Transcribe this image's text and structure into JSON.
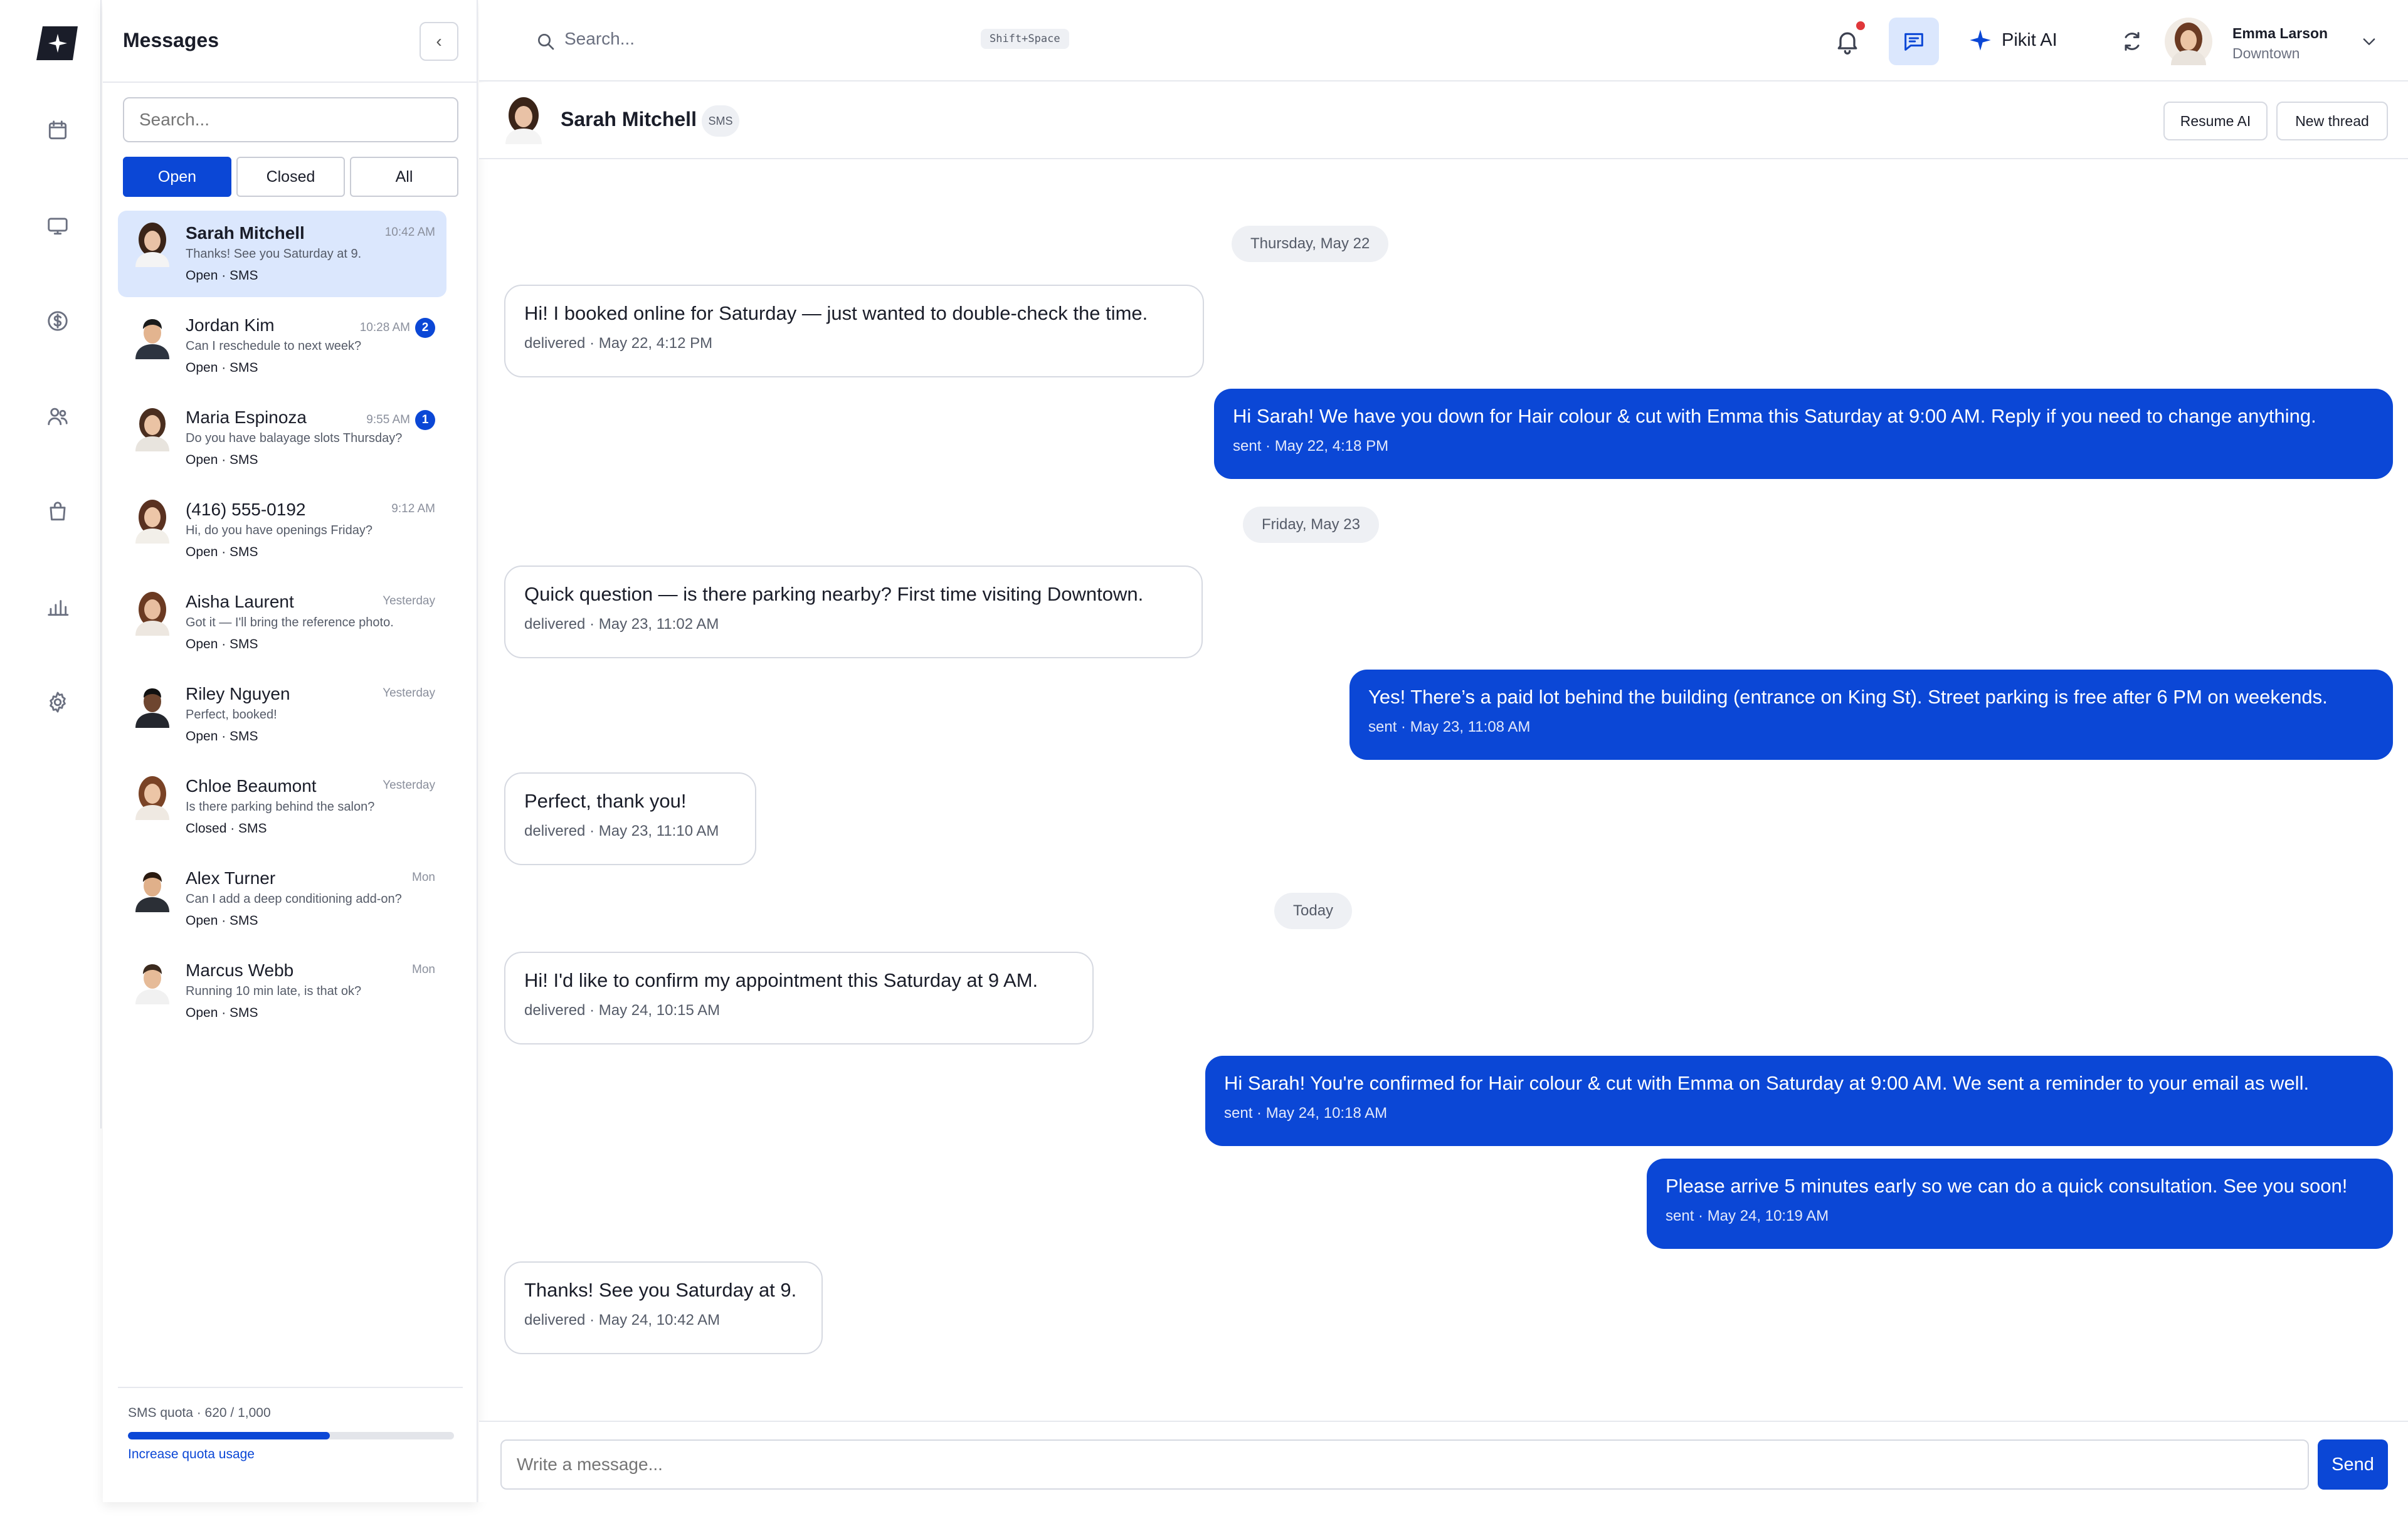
{
  "panel": {
    "title": "Messages",
    "collapse_glyph": "‹",
    "search_placeholder": "Search...",
    "filters": [
      "Open",
      "Closed",
      "All"
    ],
    "conversations": [
      {
        "name": "Sarah Mitchell",
        "time": "10:42 AM",
        "preview": "Thanks! See you Saturday at 9.",
        "status": "Open · SMS",
        "unread": "",
        "selected": true
      },
      {
        "name": "Jordan Kim",
        "time": "10:28 AM",
        "preview": "Can I reschedule to next week?",
        "status": "Open · SMS",
        "unread": "2"
      },
      {
        "name": "Maria Espinoza",
        "time": "9:55 AM",
        "preview": "Do you have balayage slots Thursday?",
        "status": "Open · SMS",
        "unread": "1"
      },
      {
        "name": "(416) 555-0192",
        "time": "9:12 AM",
        "preview": "Hi, do you have openings Friday?",
        "status": "Open · SMS",
        "unread": ""
      },
      {
        "name": "Aisha Laurent",
        "time": "Yesterday",
        "preview": "Got it — I'll bring the reference photo.",
        "status": "Open · SMS",
        "unread": ""
      },
      {
        "name": "Riley Nguyen",
        "time": "Yesterday",
        "preview": "Perfect, booked!",
        "status": "Open · SMS",
        "unread": ""
      },
      {
        "name": "Chloe Beaumont",
        "time": "Yesterday",
        "preview": "Is there parking behind the salon?",
        "status": "Closed · SMS",
        "unread": ""
      },
      {
        "name": "Alex Turner",
        "time": "Mon",
        "preview": "Can I add a deep conditioning add-on?",
        "status": "Open · SMS",
        "unread": ""
      },
      {
        "name": "Marcus Webb",
        "time": "Mon",
        "preview": "Running 10 min late, is that ok?",
        "status": "Open · SMS",
        "unread": ""
      }
    ],
    "quota": {
      "label": "SMS quota · 620 / 1,000",
      "used": 620,
      "total": 1000,
      "link": "Increase quota usage"
    }
  },
  "topbar": {
    "search_placeholder": "Search...",
    "shortcut": "Shift+Space",
    "ai_label": "Pikit AI",
    "user_name": "Emma Larson",
    "user_location": "Downtown"
  },
  "chat": {
    "contact_name": "Sarah Mitchell",
    "channel_tag": "SMS",
    "resume_ai": "Resume AI",
    "new_thread": "New thread",
    "dates": [
      "Thursday, May 22",
      "Friday, May 23",
      "Today"
    ],
    "messages": [
      {
        "dir": "in",
        "text": "Hi! I booked online for Saturday — just wanted to double-check the time.",
        "meta": "delivered · May 22, 4:12 PM"
      },
      {
        "dir": "out",
        "text": "Hi Sarah! We have you down for Hair colour & cut with Emma this Saturday at 9:00 AM. Reply if you need to change anything.",
        "meta": "sent · May 22, 4:18 PM"
      },
      {
        "dir": "in",
        "text": "Quick question — is there parking nearby? First time visiting Downtown.",
        "meta": "delivered · May 23, 11:02 AM"
      },
      {
        "dir": "out",
        "text": "Yes! There’s a paid lot behind the building (entrance on King St). Street parking is free after 6 PM on weekends.",
        "meta": "sent · May 23, 11:08 AM"
      },
      {
        "dir": "in",
        "text": "Perfect, thank you!",
        "meta": "delivered · May 23, 11:10 AM"
      },
      {
        "dir": "in",
        "text": "Hi! I'd like to confirm my appointment this Saturday at 9 AM.",
        "meta": "delivered · May 24, 10:15 AM"
      },
      {
        "dir": "out",
        "text": "Hi Sarah! You're confirmed for Hair colour & cut with Emma on Saturday at 9:00 AM. We sent a reminder to your email as well.",
        "meta": "sent · May 24, 10:18 AM"
      },
      {
        "dir": "out",
        "text": "Please arrive 5 minutes early so we can do a quick consultation. See you soon!",
        "meta": "sent · May 24, 10:19 AM"
      },
      {
        "dir": "in",
        "text": "Thanks! See you Saturday at 9.",
        "meta": "delivered · May 24, 10:42 AM"
      }
    ],
    "composer_placeholder": "Write a message...",
    "send_label": "Send"
  },
  "colors": {
    "accent": "#0b47d6",
    "selected_bg": "#dbe7fd",
    "notification_dot": "#e0373a"
  }
}
